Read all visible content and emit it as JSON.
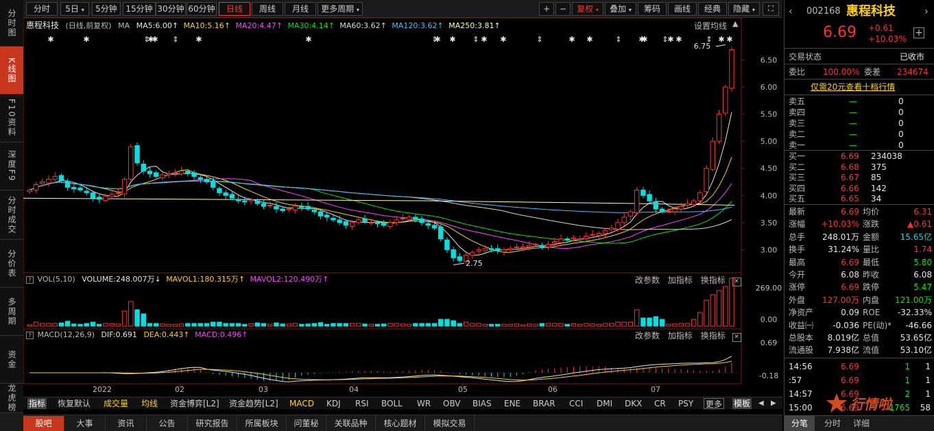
{
  "left_nav": [
    {
      "label": "分时图"
    },
    {
      "label": "K线图"
    },
    {
      "label": "F10资料"
    },
    {
      "label": "深度F9"
    },
    {
      "label": "分时成交"
    },
    {
      "label": "分价表"
    },
    {
      "label": "多周期"
    },
    {
      "label": "资金"
    },
    {
      "label": "龙虎榜"
    }
  ],
  "toolbar": {
    "periods": [
      "分时",
      "5日",
      "5分钟",
      "15分钟",
      "30分钟",
      "60分钟",
      "日线",
      "周线",
      "月线",
      "更多周期"
    ],
    "active_period": "日线",
    "plus": "+",
    "minus": "−",
    "fuquan": "复权",
    "diejia": "叠加",
    "chouma": "筹码",
    "huaxian": "画线",
    "jingdian": "经典",
    "yincang": "隐藏"
  },
  "chart_header": {
    "name": "惠程科技",
    "mode": "(日线,前复权)",
    "ma_label": "MA",
    "ma5": "MA5:6.00",
    "ma10": "MA10:5.16",
    "ma20": "MA20:4.47",
    "ma30": "MA30:4.14",
    "ma60": "MA60:3.62",
    "ma120": "MA120:3.62",
    "ma250": "MA250:3.81",
    "settings": "设置均线"
  },
  "vol_header": {
    "label": "VOL(5,10)",
    "volume": "VOLUME:248.007万",
    "mavol1": "MAVOL1:180.315万",
    "mavol2": "MAVOL2:120.490万",
    "actions": [
      "改参数",
      "加指标",
      "换指标"
    ]
  },
  "macd_header": {
    "label": "MACD(12,26,9)",
    "dif": "DIF:0.691",
    "dea": "DEA:0.443",
    "macd": "MACD:0.496",
    "actions": [
      "改参数",
      "加指标",
      "换指标"
    ]
  },
  "chart_data": {
    "type": "candlestick",
    "y_ticks": [
      "6.50",
      "6.00",
      "5.50",
      "5.00",
      "4.50",
      "4.00",
      "3.50",
      "3.00"
    ],
    "ylim": [
      2.6,
      7.0
    ],
    "x_ticks": [
      "2022",
      "02",
      "03",
      "04",
      "05",
      "06",
      "07"
    ],
    "annotations": {
      "high": "6.75",
      "low": "2.75"
    },
    "vol_ticks": [
      "269.00",
      "0.00"
    ],
    "macd_ticks": [
      "0.69",
      "-0.18"
    ],
    "close_series": [
      4.1,
      4.2,
      4.25,
      4.3,
      4.35,
      4.28,
      4.15,
      4.12,
      4.1,
      4.05,
      3.95,
      3.93,
      3.98,
      4.02,
      4.05,
      4.3,
      4.9,
      4.6,
      4.45,
      4.4,
      4.35,
      4.38,
      4.4,
      4.42,
      4.45,
      4.4,
      4.35,
      4.3,
      4.25,
      4.15,
      4.05,
      4.0,
      3.95,
      3.9,
      3.88,
      3.92,
      3.85,
      3.8,
      3.82,
      3.75,
      3.72,
      3.75,
      3.8,
      3.78,
      3.75,
      3.7,
      3.62,
      3.6,
      3.55,
      3.5,
      3.45,
      3.5,
      3.55,
      3.52,
      3.5,
      3.48,
      3.45,
      3.5,
      3.55,
      3.58,
      3.6,
      3.55,
      3.5,
      3.45,
      3.4,
      3.2,
      3.0,
      2.85,
      2.8,
      2.9,
      2.95,
      3.0,
      3.02,
      3.0,
      2.98,
      3.0,
      3.02,
      3.05,
      3.05,
      3.08,
      3.1,
      3.05,
      3.1,
      3.15,
      3.2,
      3.18,
      3.22,
      3.2,
      3.25,
      3.28,
      3.3,
      3.35,
      3.4,
      3.5,
      3.6,
      3.7,
      4.1,
      4.0,
      3.9,
      3.75,
      3.7,
      3.72,
      3.75,
      3.8,
      3.85,
      3.9,
      4.05,
      4.5,
      5.0,
      5.5,
      6.0,
      6.69
    ],
    "volume": {
      "unit": "万",
      "last": 248.007,
      "mavol1": 180.315,
      "mavol2": 120.49
    },
    "macd": {
      "dif": 0.691,
      "dea": 0.443,
      "macd": 0.496
    }
  },
  "indicator_tabs": [
    "指标",
    "恢复默认",
    "成交量",
    "均线",
    "资金博弈[L2]",
    "资金趋势[L2]",
    "MACD",
    "KDJ",
    "RSI",
    "BOLL",
    "WR",
    "OBV",
    "BIAS",
    "ENE",
    "BRAR",
    "CCI",
    "DMI",
    "DKX",
    "CR",
    "PSY",
    "更多",
    "模板"
  ],
  "bottom_tabs": [
    "股吧",
    "大事",
    "资讯",
    "公告",
    "研究报告",
    "所属板块",
    "问董秘",
    "关联品种",
    "核心题材",
    "模拟交易"
  ],
  "quote": {
    "code": "002168",
    "name": "惠程科技",
    "price": "6.69",
    "change": "+0.61",
    "change_pct": "+10.03%",
    "status_label": "交易状态",
    "status": "已收市",
    "weibi_label": "委比",
    "weibi": "100.00%",
    "weicha_label": "委差",
    "weicha": "234674",
    "ten_levels": "仅需20元查看十档行情",
    "sells": [
      {
        "label": "卖五",
        "price": "—",
        "vol": "0"
      },
      {
        "label": "卖四",
        "price": "—",
        "vol": "0"
      },
      {
        "label": "卖三",
        "price": "—",
        "vol": "0"
      },
      {
        "label": "卖二",
        "price": "—",
        "vol": "0"
      },
      {
        "label": "卖一",
        "price": "—",
        "vol": "0"
      }
    ],
    "buys": [
      {
        "label": "买一",
        "price": "6.69",
        "vol": "234038"
      },
      {
        "label": "买二",
        "price": "6.68",
        "vol": "375"
      },
      {
        "label": "买三",
        "price": "6.67",
        "vol": "85"
      },
      {
        "label": "买四",
        "price": "6.66",
        "vol": "142"
      },
      {
        "label": "买五",
        "price": "6.65",
        "vol": "34"
      }
    ],
    "stats": [
      {
        "l1": "最新",
        "v1": "6.69",
        "c1": "red",
        "l2": "均价",
        "v2": "6.31",
        "c2": "red"
      },
      {
        "l1": "涨幅",
        "v1": "+10.03%",
        "c1": "red",
        "l2": "涨跌",
        "v2": "▲0.61",
        "c2": "red"
      },
      {
        "l1": "总手",
        "v1": "248.01万",
        "c1": "white",
        "l2": "金额",
        "v2": "15.65亿",
        "c2": "cyan"
      },
      {
        "l1": "换手",
        "v1": "31.24%",
        "c1": "white",
        "l2": "量比",
        "v2": "1.74",
        "c2": "red"
      },
      {
        "l1": "最高",
        "v1": "6.69",
        "c1": "red",
        "l2": "最低",
        "v2": "5.80",
        "c2": "green"
      },
      {
        "l1": "今开",
        "v1": "6.08",
        "c1": "white",
        "l2": "昨收",
        "v2": "6.08",
        "c2": "white"
      },
      {
        "l1": "涨停",
        "v1": "6.69",
        "c1": "red",
        "l2": "跌停",
        "v2": "5.47",
        "c2": "green"
      },
      {
        "l1": "外盘",
        "v1": "127.00万",
        "c1": "red",
        "l2": "内盘",
        "v2": "121.00万",
        "c2": "green"
      },
      {
        "l1": "净资产",
        "v1": "0.09",
        "c1": "white",
        "l2": "ROE",
        "v2": "-32.33%",
        "c2": "white"
      },
      {
        "l1": "收益㈠",
        "v1": "-0.036",
        "c1": "white",
        "l2": "PE(动)*",
        "v2": "-46.66",
        "c2": "white"
      },
      {
        "l1": "总股本",
        "v1": "8.019亿",
        "c1": "white",
        "l2": "总值",
        "v2": "53.65亿",
        "c2": "white"
      },
      {
        "l1": "流通股",
        "v1": "7.938亿",
        "c1": "white",
        "l2": "流值",
        "v2": "53.10亿",
        "c2": "white"
      }
    ],
    "ticks": [
      {
        "time": "14:56",
        "price": "6.69",
        "vol": "1",
        "n": "1"
      },
      {
        "time": ":57",
        "price": "6.69",
        "vol": "1",
        "n": "1"
      },
      {
        "time": "14:57",
        "price": "6.69",
        "vol": "2",
        "n": "1"
      },
      {
        "time": "15:00",
        "price": "6.69",
        "vol": "1765",
        "n": "58"
      }
    ],
    "tabs": [
      "分笔",
      "分时",
      "详细"
    ],
    "watermark": "行情啦"
  }
}
